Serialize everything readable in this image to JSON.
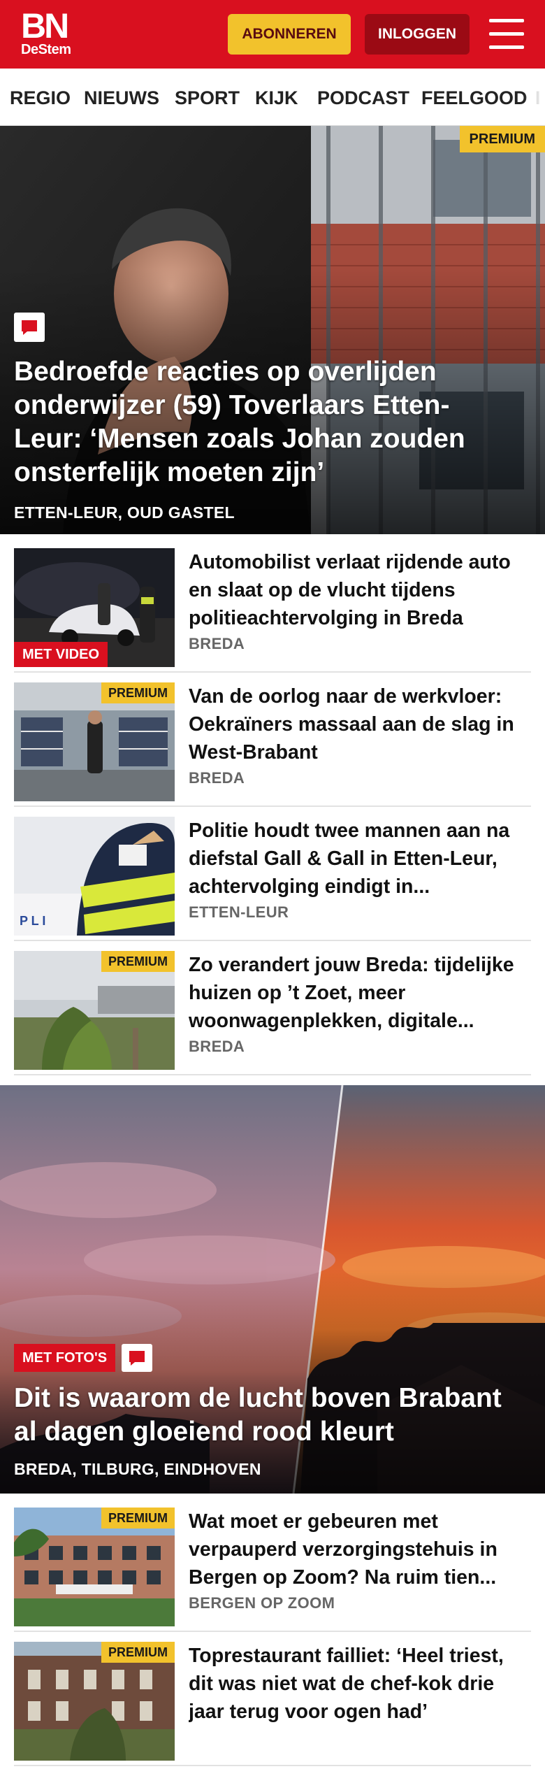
{
  "header": {
    "logo_main": "BN",
    "logo_sub": "DeStem",
    "subscribe_label": "ABONNEREN",
    "login_label": "INLOGGEN"
  },
  "nav": {
    "items": [
      "REGIO",
      "NIEUWS",
      "SPORT",
      "KIJK",
      "PODCAST",
      "FEELGOOD",
      "I"
    ]
  },
  "colors": {
    "brand_red": "#d9101f",
    "premium_yellow": "#f2c22c",
    "login_dark_red": "#9b0a14"
  },
  "hero1": {
    "premium_label": "PREMIUM",
    "title": "Bedroefde reacties op overlijden onderwijzer (59) Toverlaars Etten-Leur: ‘Mensen zoals Johan zouden onsterfelijk moeten zijn’",
    "location": "ETTEN-LEUR, OUD GASTEL",
    "icon": "comment-icon"
  },
  "list1": [
    {
      "title": "Automobilist verlaat rijdende auto en slaat op de vlucht tijdens politieachtervolging in Breda",
      "location": "BREDA",
      "badge": "MET VIDEO",
      "premium": ""
    },
    {
      "title": "Van de oorlog naar de werkvloer: Oekraïners massaal aan de slag in West-Brabant",
      "location": "BREDA",
      "badge": "",
      "premium": "PREMIUM"
    },
    {
      "title": "Politie houdt twee mannen aan na diefstal Gall & Gall in Etten-Leur, achtervolging eindigt in...",
      "location": "ETTEN-LEUR",
      "badge": "",
      "premium": ""
    },
    {
      "title": "Zo verandert jouw Breda: tijdelijke huizen op ’t Zoet, meer woonwagenplekken, digitale...",
      "location": "BREDA",
      "badge": "",
      "premium": "PREMIUM"
    }
  ],
  "hero2": {
    "badge": "MET FOTO'S",
    "title": "Dit is waarom de lucht boven Brabant al dagen gloeiend rood kleurt",
    "location": "BREDA, TILBURG, EINDHOVEN",
    "icon": "comment-icon"
  },
  "list2": [
    {
      "title": "Wat moet er gebeuren met verpauperd verzorgingstehuis in Bergen op Zoom? Na ruim tien...",
      "location": "BERGEN OP ZOOM",
      "premium": "PREMIUM"
    },
    {
      "title": "Toprestaurant failliet: ‘Heel triest, dit was niet wat de chef-kok drie jaar terug voor ogen had’",
      "location": "",
      "premium": "PREMIUM"
    }
  ]
}
